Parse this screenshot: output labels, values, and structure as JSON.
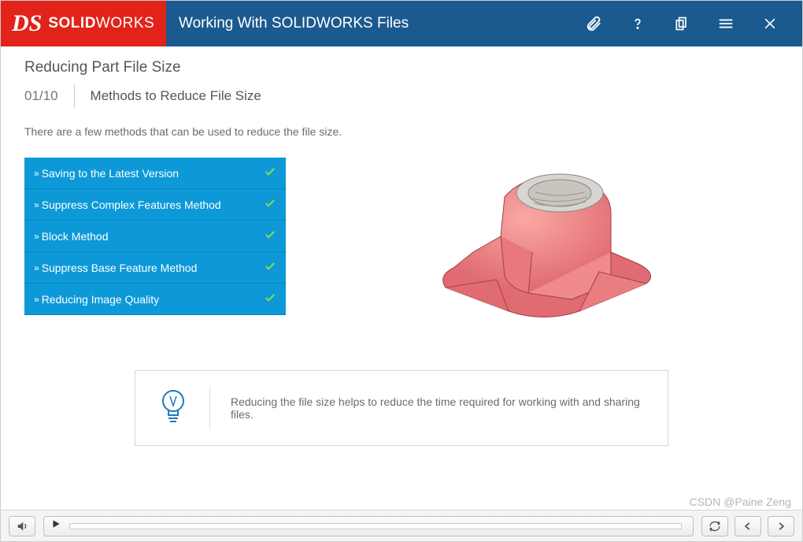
{
  "header": {
    "logo_prefix": "SOLID",
    "logo_suffix": "WORKS",
    "title": "Working With SOLIDWORKS Files"
  },
  "subtitle": "Reducing Part File Size",
  "progress": "01/10",
  "section": "Methods to Reduce File Size",
  "description": "There are a few methods that can be used to reduce the file size.",
  "items": [
    {
      "label": "Saving to the Latest Version"
    },
    {
      "label": "Suppress Complex Features Method"
    },
    {
      "label": "Block Method"
    },
    {
      "label": "Suppress Base Feature Method"
    },
    {
      "label": "Reducing Image Quality"
    }
  ],
  "tip": "Reducing the file size helps to reduce the time required for working with and sharing files.",
  "watermark": "CSDN @Paine Zeng"
}
